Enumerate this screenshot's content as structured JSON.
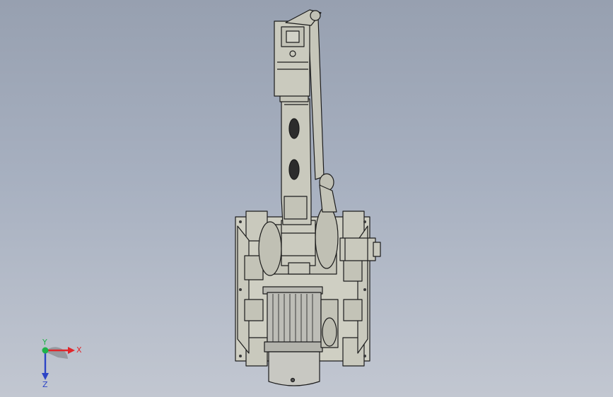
{
  "viewport": {
    "background_top": "#97a0b0",
    "background_bottom": "#c2c7d1"
  },
  "model": {
    "fill": "#c9c9bd",
    "edge": "#1c1c1c",
    "motor_fill": "#bdbdb7"
  },
  "triad": {
    "x_label": "X",
    "y_label": "Y",
    "z_label": "Z",
    "x_color": "#e0262b",
    "y_color": "#1fb34a",
    "z_color": "#2c44c6"
  }
}
